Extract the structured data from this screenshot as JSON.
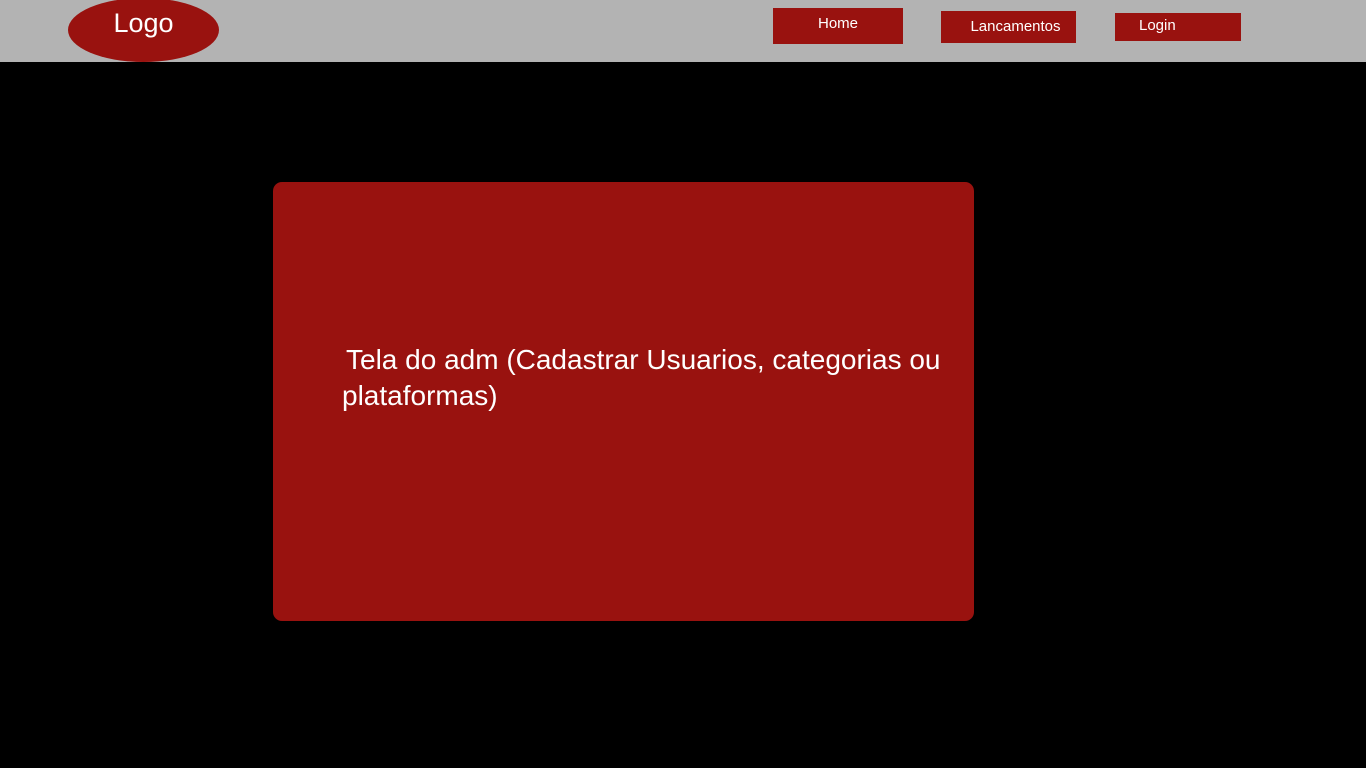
{
  "header": {
    "logo_text": "Logo",
    "nav": {
      "home": "Home",
      "lancamentos": "Lancamentos",
      "login": "Login"
    }
  },
  "main": {
    "panel_text": "Tela do adm (Cadastrar Usuarios, categorias ou plataformas)"
  },
  "colors": {
    "header_bg": "#b3b3b3",
    "accent": "#99120f",
    "page_bg": "#000000",
    "text": "#ffffff"
  }
}
